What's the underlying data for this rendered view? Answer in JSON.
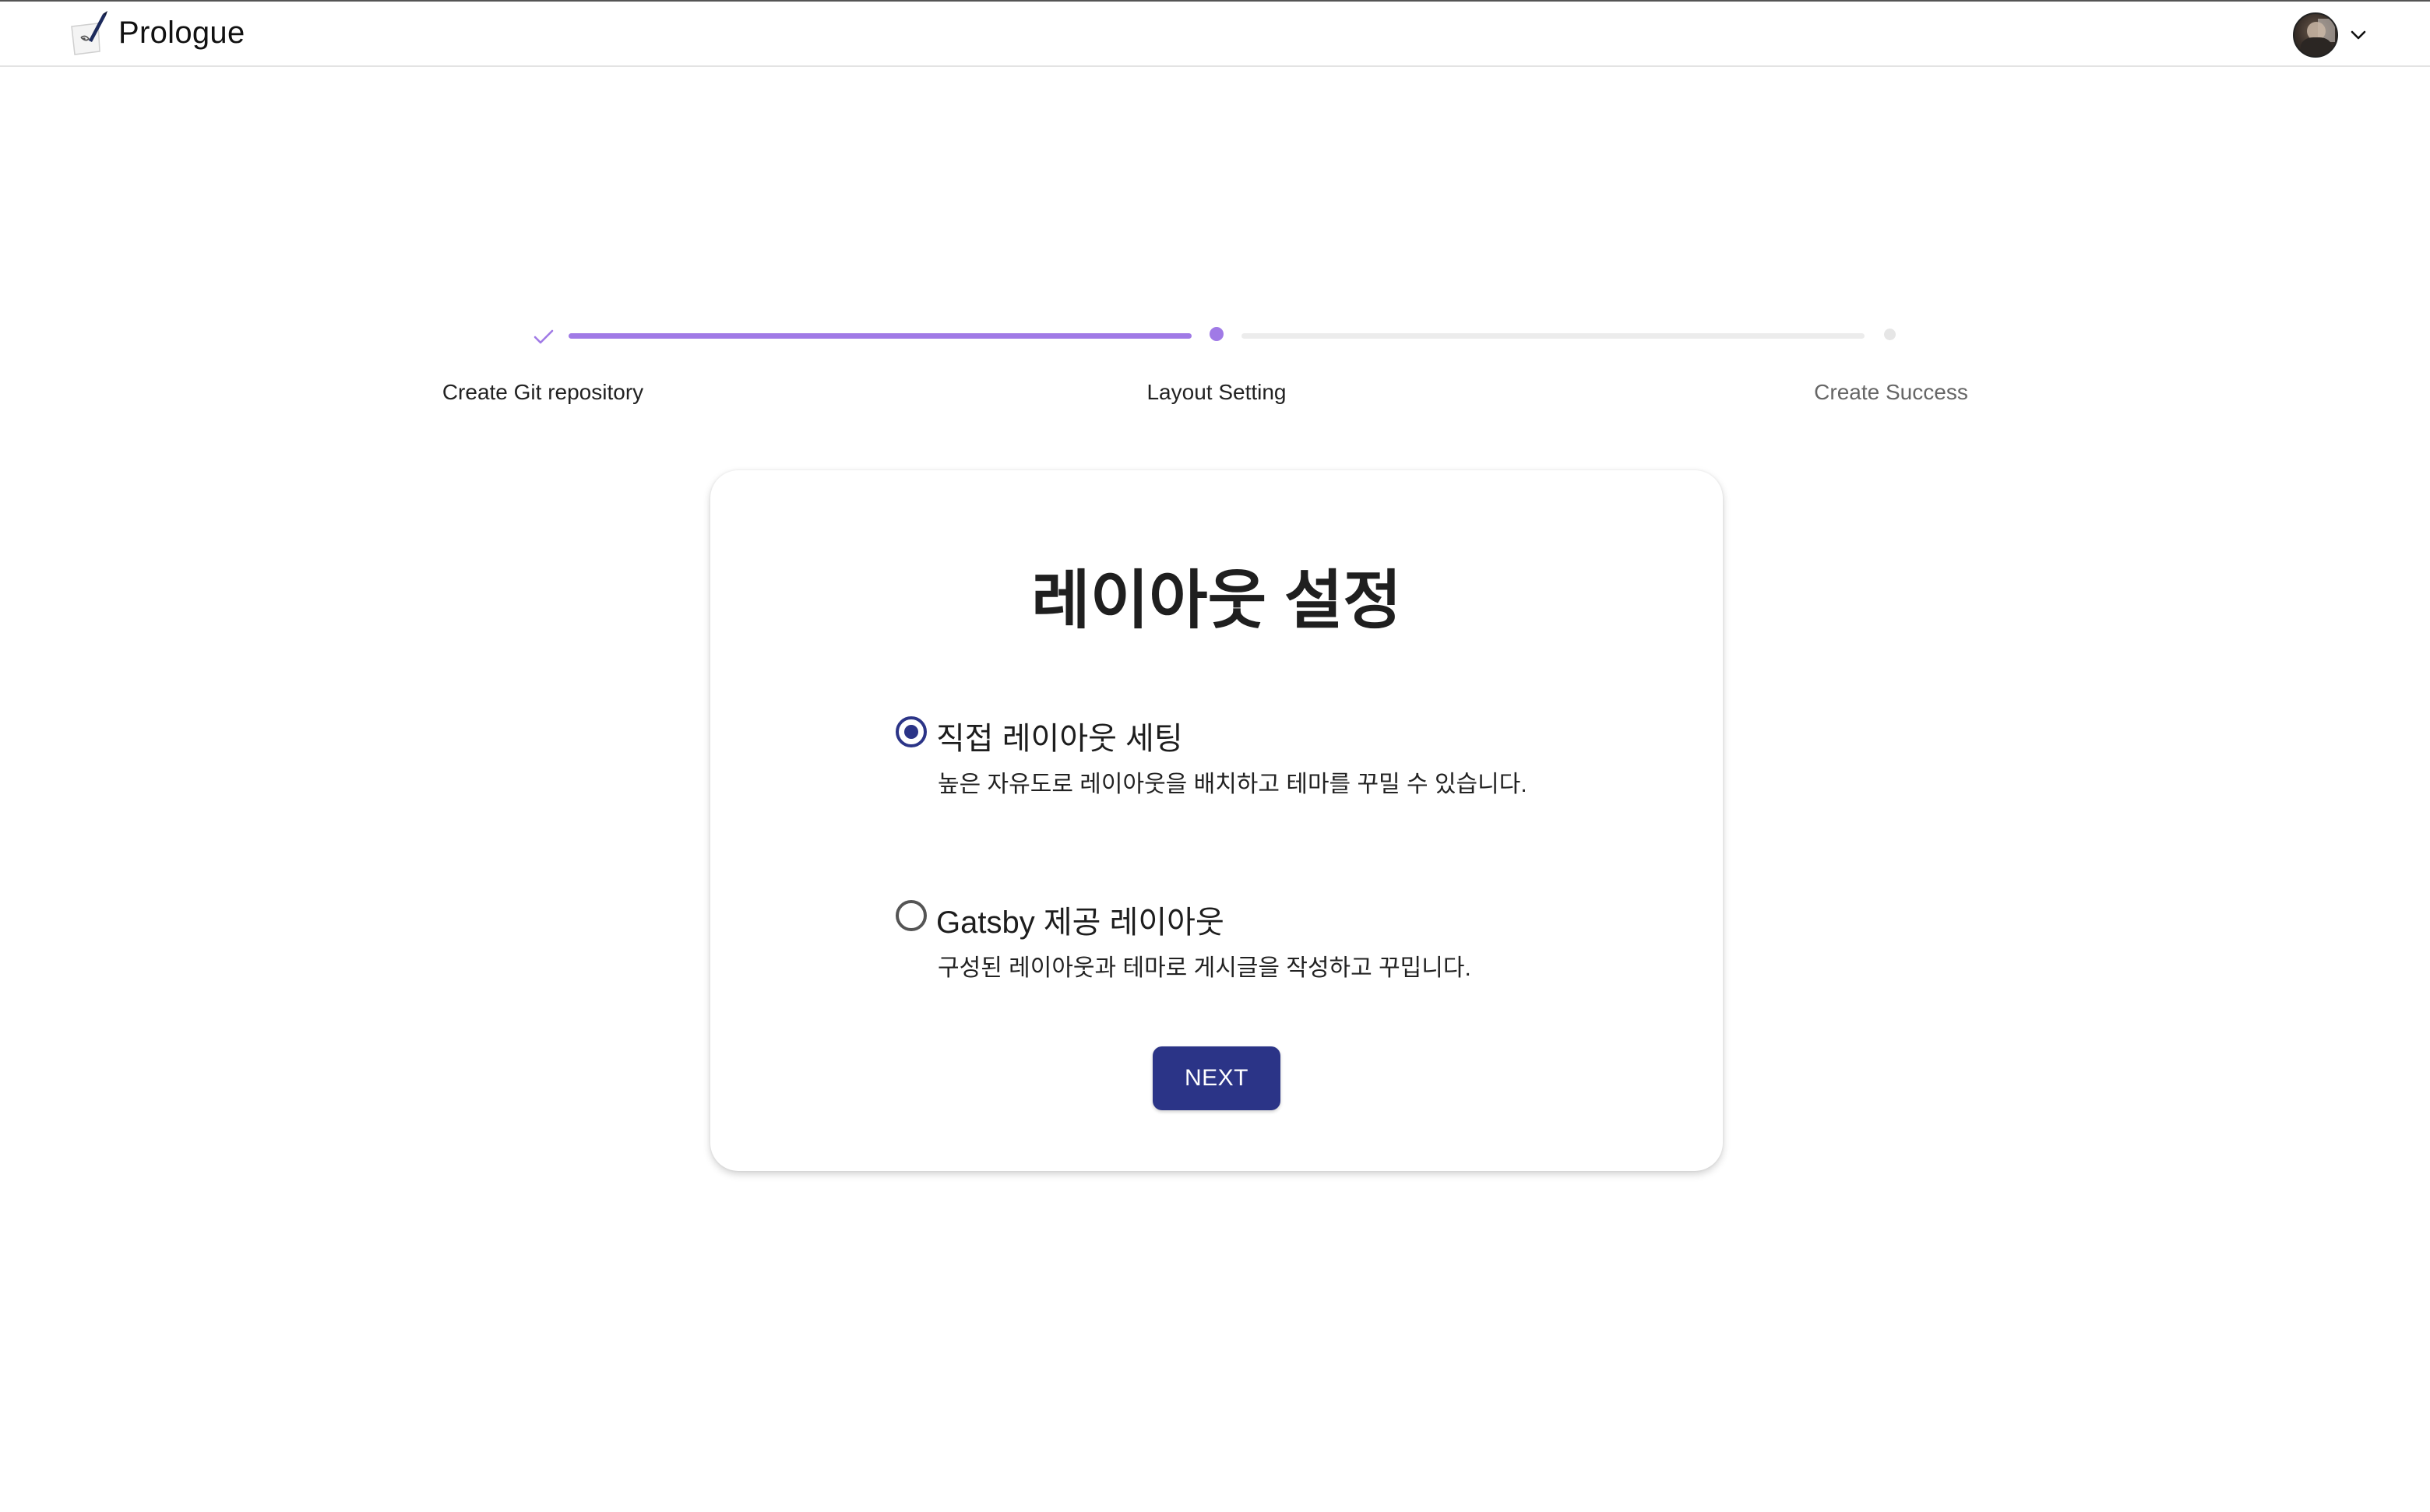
{
  "header": {
    "app_name": "Prologue",
    "logo_icon": "quill-paper-logo",
    "profile_menu_icon": "chevron-down-icon"
  },
  "stepper": {
    "steps": [
      {
        "label": "Create Git repository",
        "status": "completed"
      },
      {
        "label": "Layout Setting",
        "status": "active"
      },
      {
        "label": "Create Success",
        "status": "pending"
      }
    ],
    "progress_fraction": 0.5,
    "accent_color": "#a07ae6"
  },
  "card": {
    "title": "레이아웃 설정",
    "options": [
      {
        "title": "직접 레이아웃 세팅",
        "description": "높은 자유도로 레이아웃을 배치하고 테마를 꾸밀 수 있습니다.",
        "selected": true
      },
      {
        "title": "Gatsby 제공 레이아웃",
        "description": "구성된 레이아웃과 테마로 게시글을 작성하고 꾸밉니다.",
        "selected": false
      }
    ],
    "next_label": "NEXT",
    "primary_color": "#2b3487"
  }
}
